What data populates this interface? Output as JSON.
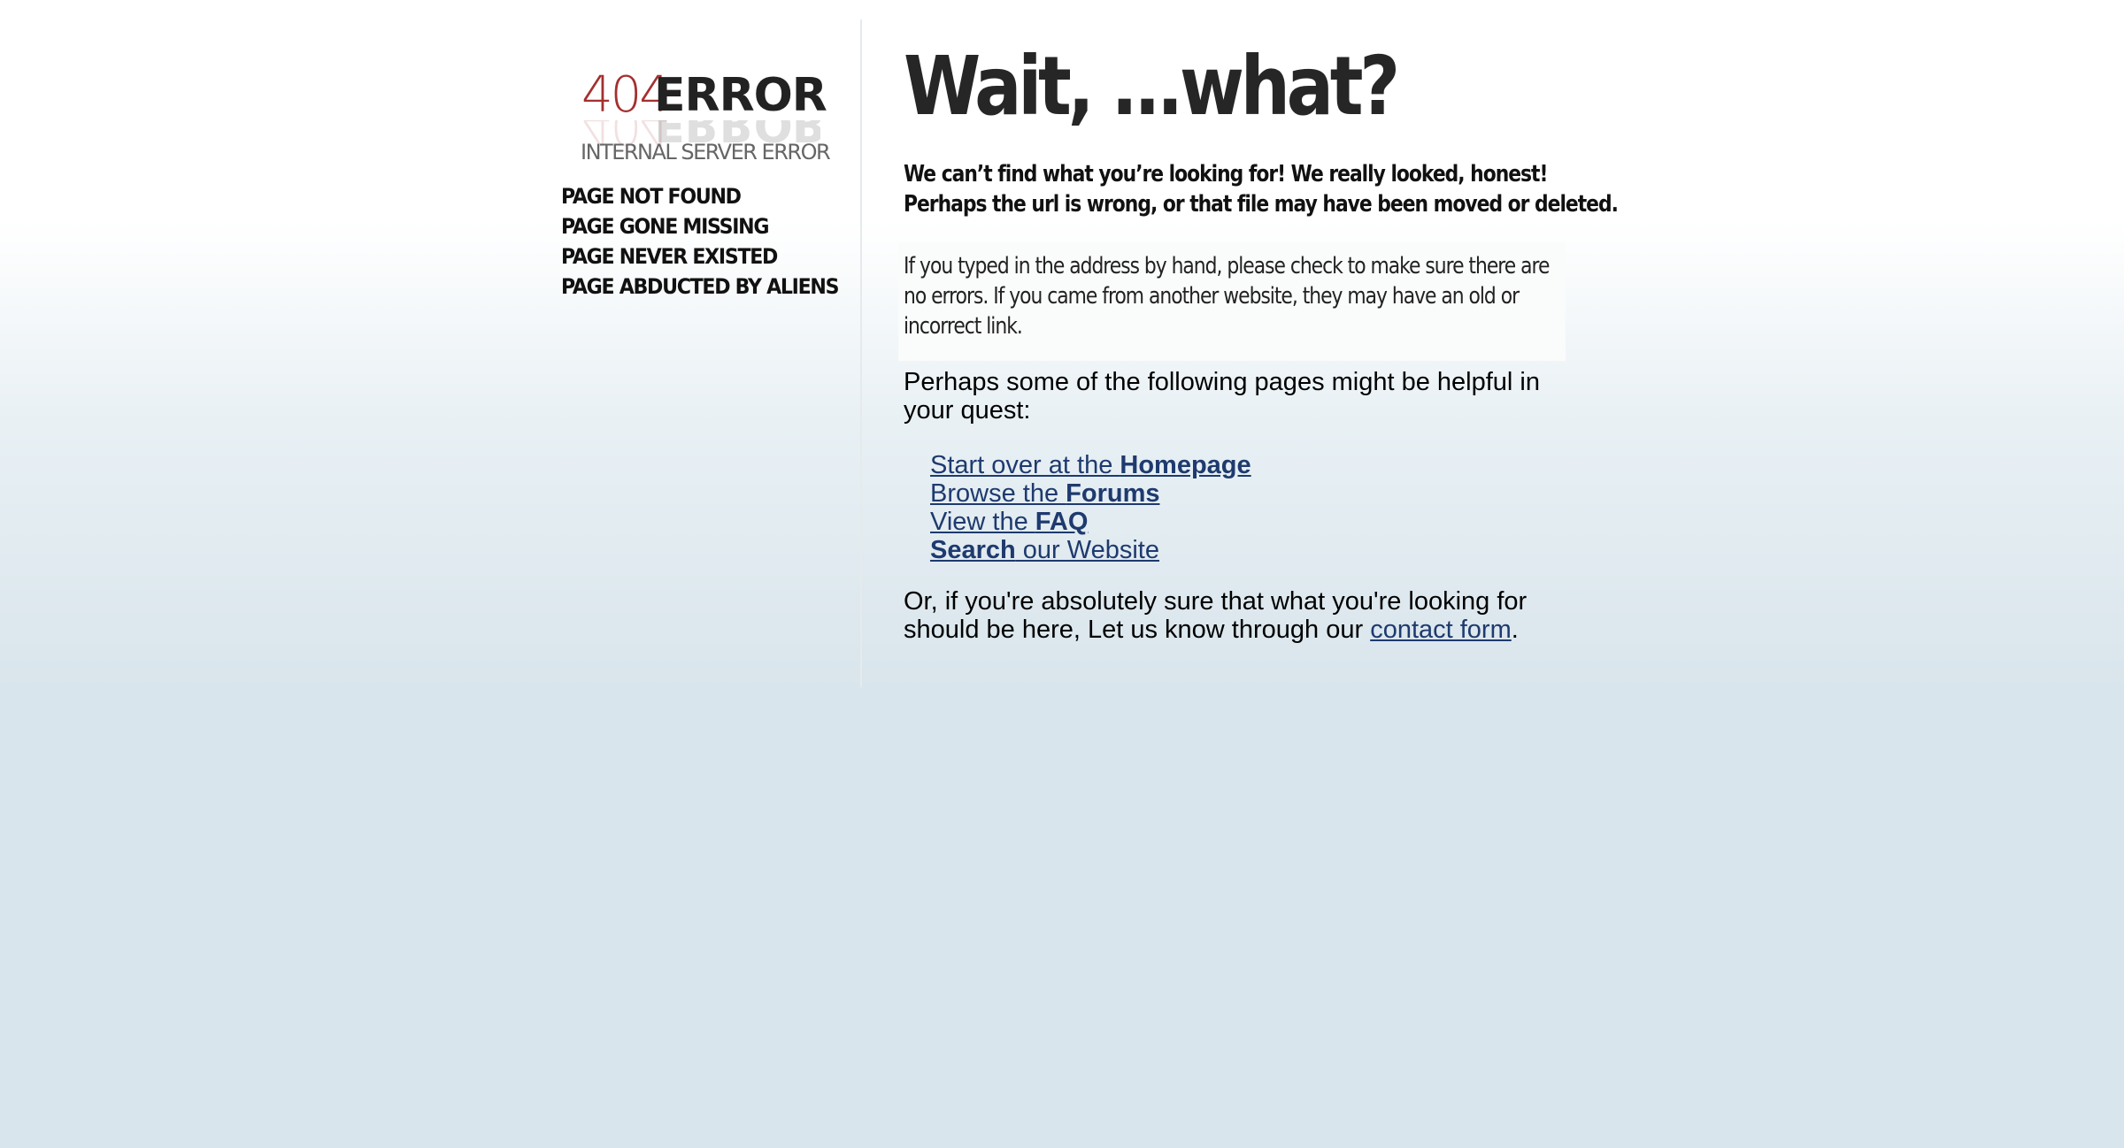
{
  "logo": {
    "code": "404",
    "word": "ERROR",
    "subtitle": "INTERNAL SERVER ERROR"
  },
  "reasons": [
    "PAGE NOT FOUND",
    "PAGE GONE MISSING",
    "PAGE NEVER EXISTED",
    "PAGE ABDUCTED BY ALIENS"
  ],
  "headline": "Wait, ...what?",
  "lead": {
    "line1": "We can’t find what you’re looking for! We really looked, honest!",
    "line2": "Perhaps the url is wrong, or that file may have been moved or deleted."
  },
  "hint": "If you typed in the address by hand, please check to make sure there are no errors. If you came from another website, they may have an old or incorrect link.",
  "intro": "Perhaps some of the following pages might be helpful in your quest:",
  "links": {
    "homepage": {
      "pre": "Start over at the ",
      "bold": "Homepage"
    },
    "forums": {
      "pre": "Browse the ",
      "bold": "Forums"
    },
    "faq": {
      "pre": "View the ",
      "bold": "FAQ"
    },
    "search": {
      "bold": "Search",
      "post": " our Website"
    }
  },
  "outro": {
    "text": "Or, if you're absolutely sure that what you're looking for should be here, Let us know through our ",
    "link": "contact form",
    "end": "."
  }
}
